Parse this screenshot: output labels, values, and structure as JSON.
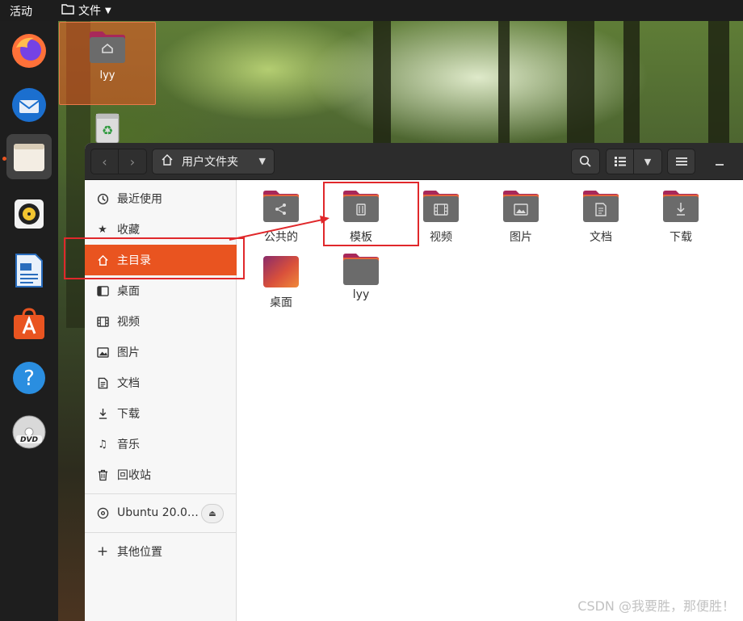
{
  "topbar": {
    "activities": "活动",
    "app_menu": "文件"
  },
  "desktop": {
    "home_folder_label": "lyy"
  },
  "dock": {
    "items": [
      "firefox-icon",
      "thunderbird-icon",
      "files-icon",
      "rhythmbox-icon",
      "writer-icon",
      "software-icon",
      "help-icon",
      "dvd-icon"
    ]
  },
  "window": {
    "path_label": "用户文件夹",
    "sidebar": {
      "recent": "最近使用",
      "starred": "收藏",
      "home": "主目录",
      "desktop": "桌面",
      "videos": "视频",
      "pictures": "图片",
      "documents": "文档",
      "downloads": "下载",
      "music": "音乐",
      "trash": "回收站",
      "drive": "Ubuntu 20.0…",
      "other": "其他位置"
    },
    "folders": [
      "公共的",
      "模板",
      "视频",
      "图片",
      "文档",
      "下载",
      "桌面",
      "lyy"
    ]
  },
  "colors": {
    "accent": "#e95420",
    "folder_body": "#6b6b6b",
    "folder_tab": "#a8285a",
    "annotation": "#e0282b"
  },
  "watermark": "CSDN @我要胜，那便胜！"
}
